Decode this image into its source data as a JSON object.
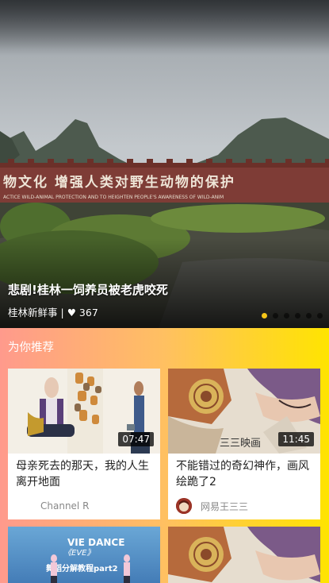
{
  "hero": {
    "title": "悲剧!桂林一饲养员被老虎咬死",
    "source": "桂林新鲜事",
    "separator": "|",
    "likes_icon": "heart-icon",
    "likes": "♥ 367",
    "banner_text": "物文化  增强人类对野生动物的保护",
    "banner_subtext": "ACTICE WILD-ANIMAL PROTECTION AND TO HEIGHTEN PEOPLE'S AWARENESS OF WILD-ANIM",
    "slides_total": 6,
    "active_slide": 1
  },
  "recommend": {
    "section_title": "为你推荐",
    "cards": [
      {
        "title": "母亲死去的那天，我的人生离开地面",
        "author": "Channel R",
        "duration": "07:47",
        "has_avatar": false
      },
      {
        "title": "不能错过的奇幻神作，画风绘跪了2",
        "author": "网易王三三",
        "duration": "11:45",
        "has_avatar": true,
        "thumb_caption": "三三映画"
      },
      {
        "thumb_caption": "VIE DANCE 《EVE》 舞蹈分解教程part2"
      },
      {
        "thumb_caption": ""
      }
    ]
  },
  "colors": {
    "gradient_start": "#ff9a8c",
    "gradient_end": "#ffe400",
    "active_dot": "#f5c518"
  }
}
